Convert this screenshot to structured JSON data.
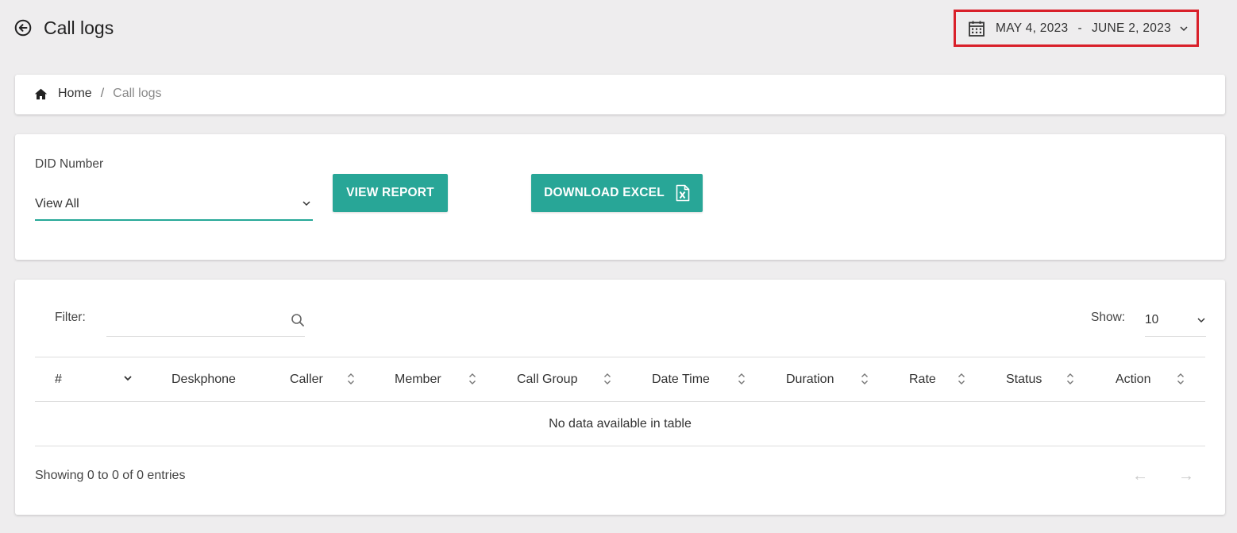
{
  "header": {
    "title": "Call logs",
    "date_start": "MAY 4, 2023",
    "date_sep": "-",
    "date_end": "JUNE 2, 2023"
  },
  "breadcrumb": {
    "home": "Home",
    "separator": "/",
    "current": "Call logs"
  },
  "form": {
    "did_label": "DID Number",
    "did_value": "View All",
    "view_report": "VIEW REPORT",
    "download_excel": "DOWNLOAD EXCEL"
  },
  "table": {
    "filter_label": "Filter:",
    "filter_value": "",
    "show_label": "Show:",
    "show_value": "10",
    "columns": [
      "#",
      "Deskphone",
      "Caller",
      "Member",
      "Call Group",
      "Date Time",
      "Duration",
      "Rate",
      "Status",
      "Action"
    ],
    "empty_message": "No data available in table",
    "info": "Showing 0 to 0 of 0 entries",
    "prev": "←",
    "next": "→"
  },
  "colors": {
    "accent": "#28a697",
    "highlight_border": "#d9202a",
    "background": "#eeedee"
  },
  "icons": {
    "back": "arrow-left-circle-icon",
    "calendar": "calendar-icon",
    "home": "home-icon",
    "search": "search-icon",
    "excel": "excel-file-icon",
    "chevron": "chevron-down-icon",
    "sort": "sort-icon"
  }
}
